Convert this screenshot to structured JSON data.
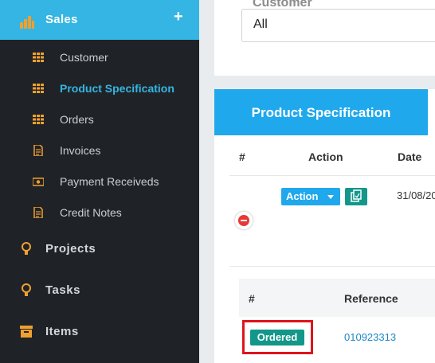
{
  "sidebar": {
    "sales": {
      "label": "Sales",
      "expand_icon": "plus-icon"
    },
    "sub_items": [
      {
        "label": "Customer",
        "icon": "grid-icon"
      },
      {
        "label": "Product Specification",
        "icon": "grid-icon",
        "active": true
      },
      {
        "label": "Orders",
        "icon": "grid-icon"
      },
      {
        "label": "Invoices",
        "icon": "document-icon"
      },
      {
        "label": "Payment Receiveds",
        "icon": "money-icon"
      },
      {
        "label": "Credit Notes",
        "icon": "document-icon"
      }
    ],
    "main_items": [
      {
        "label": "Projects",
        "icon": "lightbulb-icon"
      },
      {
        "label": "Tasks",
        "icon": "lightbulb-icon"
      },
      {
        "label": "Items",
        "icon": "archive-icon"
      }
    ]
  },
  "filter": {
    "customer_label": "Customer",
    "customer_value": "All"
  },
  "tabs": {
    "active_label": "Product Specification"
  },
  "table": {
    "headers": {
      "hash": "#",
      "action": "Action",
      "date": "Date"
    },
    "row": {
      "action_label": "Action",
      "date": "31/08/20"
    }
  },
  "sub_table": {
    "headers": {
      "hash": "#",
      "reference": "Reference"
    },
    "row": {
      "status": "Ordered",
      "reference": "010923313"
    }
  },
  "colors": {
    "accent": "#35b5e3",
    "tab": "#1fa8ec",
    "sidebar": "#1f2327",
    "icon_orange": "#f0a030",
    "teal": "#13978a",
    "highlight": "#e0141b"
  }
}
